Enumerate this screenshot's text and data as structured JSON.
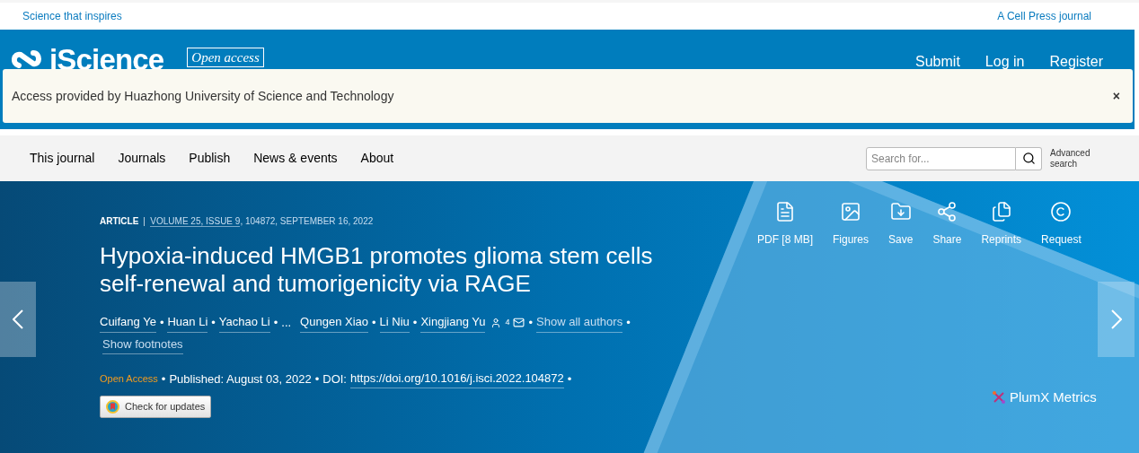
{
  "top_bar": {
    "tagline": "Science that inspires",
    "publisher": "A Cell Press journal"
  },
  "header": {
    "logo": "iScience",
    "badge": "Open access",
    "links": [
      "Submit",
      "Log in",
      "Register"
    ]
  },
  "notice": {
    "text": "Access provided by Huazhong University of Science and Technology",
    "close": "×"
  },
  "nav": {
    "items": [
      "This journal",
      "Journals",
      "Publish",
      "News & events",
      "About"
    ],
    "search": {
      "placeholder": "Search for..."
    },
    "advanced": "Advanced search"
  },
  "article": {
    "type": "ARTICLE",
    "issue_link": "VOLUME 25, ISSUE 9",
    "citation": ", 104872, SEPTEMBER 16, 2022",
    "title": "Hypoxia-induced HMGB1 promotes glioma stem cells self-renewal and tumorigenicity via RAGE",
    "authors": [
      "Cuifang Ye",
      "Huan Li",
      "Yachao Li"
    ],
    "ellipsis": "...",
    "authors_after": [
      "Qungen Xiao",
      "Li Niu",
      "Xingjiang Yu"
    ],
    "author_footnote": "4",
    "show_all": "Show all authors",
    "show_footnotes": "Show footnotes",
    "open_access": "Open Access",
    "published": "Published: August 03, 2022",
    "doi_label": "DOI:",
    "doi": "https://doi.org/10.1016/j.isci.2022.104872",
    "updates": "Check for updates"
  },
  "actions": [
    {
      "kind": "pdf",
      "label": "PDF [8 MB]"
    },
    {
      "kind": "figures",
      "label": "Figures"
    },
    {
      "kind": "save",
      "label": "Save"
    },
    {
      "kind": "share",
      "label": "Share"
    },
    {
      "kind": "reprints",
      "label": "Reprints"
    },
    {
      "kind": "request",
      "label": "Request"
    }
  ],
  "metrics": "PlumX Metrics",
  "separator": "•"
}
